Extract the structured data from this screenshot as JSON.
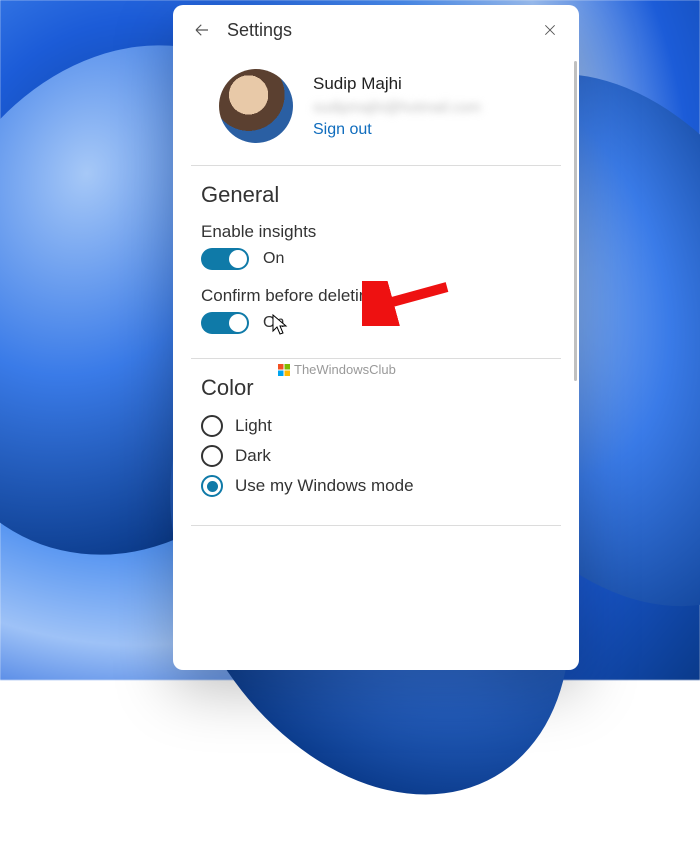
{
  "header": {
    "title": "Settings"
  },
  "account": {
    "name": "Sudip Majhi",
    "email_masked": "sudipmajhi@hotmail.com",
    "signout": "Sign out"
  },
  "sections": {
    "general": {
      "title": "General",
      "enable_insights": {
        "label": "Enable insights",
        "state": "On",
        "on": true
      },
      "confirm_delete": {
        "label": "Confirm before deleting",
        "state": "On",
        "on": true
      }
    },
    "color": {
      "title": "Color",
      "options": {
        "light": {
          "label": "Light",
          "selected": false
        },
        "dark": {
          "label": "Dark",
          "selected": false
        },
        "winmode": {
          "label": "Use my Windows mode",
          "selected": true
        }
      }
    }
  },
  "watermark": "TheWindowsClub"
}
